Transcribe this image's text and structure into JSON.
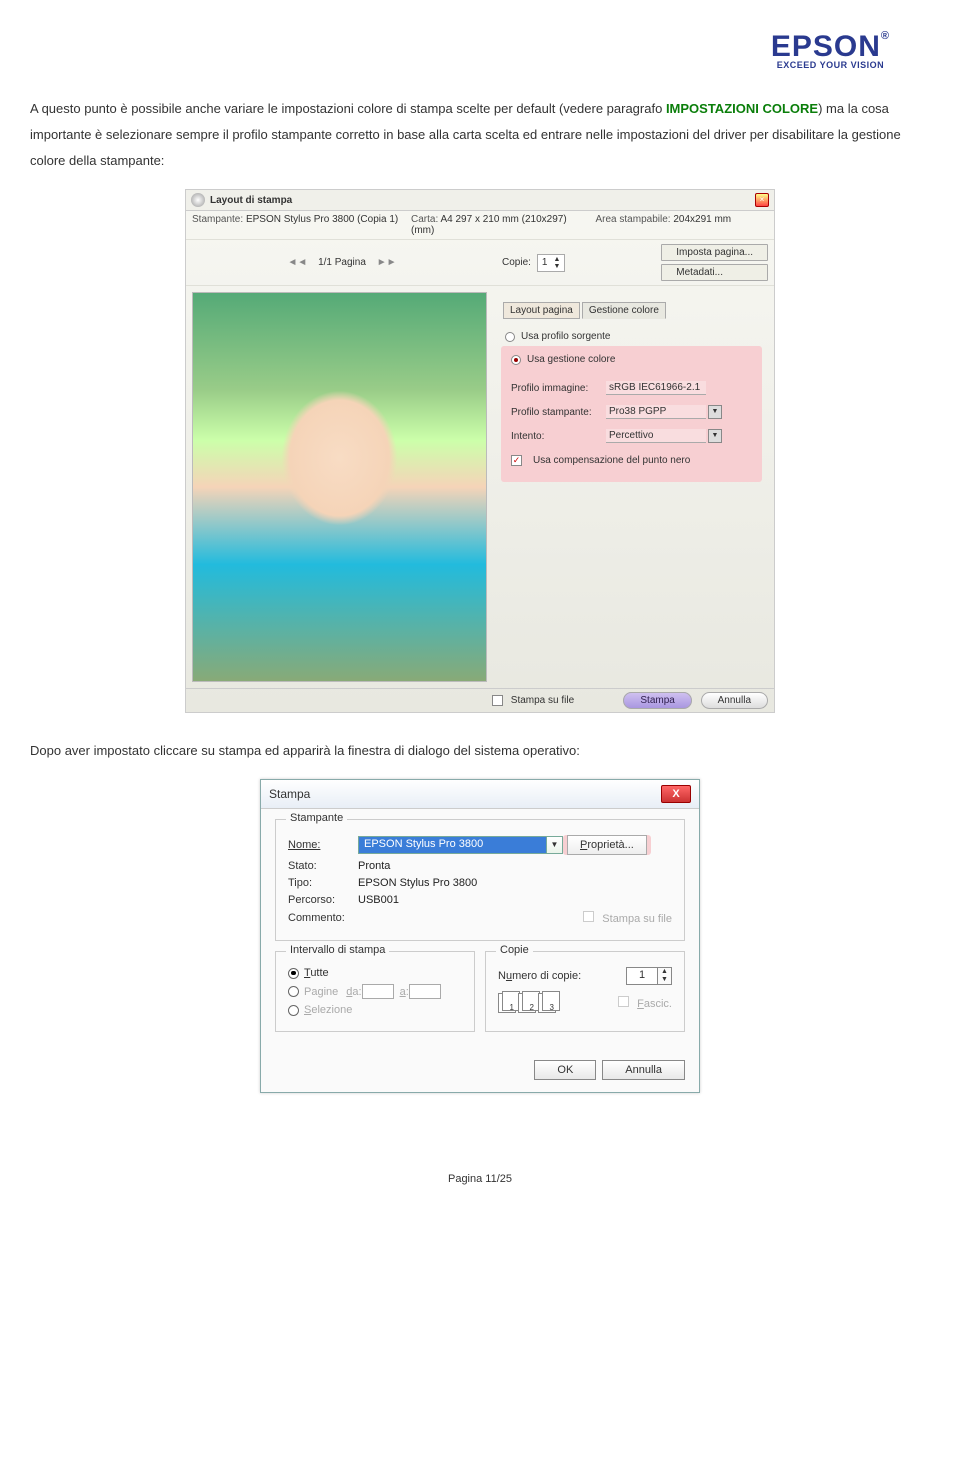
{
  "logo": {
    "title": "EPSON",
    "reg": "®",
    "tagline": "EXCEED YOUR VISION"
  },
  "para1": {
    "t1": "A questo punto è possibile anche variare le impostazioni colore di stampa scelte per default (vedere  paragrafo ",
    "imp": "IMPOSTAZIONI COLORE",
    "imp_close": ")",
    "t2": " ma la cosa importante è selezionare sempre il profilo stampante corretto in base alla carta scelta ed entrare nelle impostazioni del driver per disabilitare la gestione colore della stampante:"
  },
  "dialog1": {
    "title": "Layout di stampa",
    "printer_lbl": "Stampante:",
    "printer_val": "EPSON Stylus Pro 3800 (Copia 1)",
    "paper_lbl": "Carta:",
    "paper_val": "A4 297 x 210 mm (210x297) (mm)",
    "area_lbl": "Area stampabile:",
    "area_val": "204x291 mm",
    "pager": "1/1 Pagina",
    "copies_lbl": "Copie:",
    "copies_val": "1",
    "btn_page": "Imposta pagina...",
    "btn_meta": "Metadati...",
    "tab1": "Layout pagina",
    "tab2": "Gestione colore",
    "radio1": "Usa profilo sorgente",
    "radio2": "Usa gestione colore",
    "f1l": "Profilo immagine:",
    "f1v": "sRGB IEC61966-2.1",
    "f2l": "Profilo stampante:",
    "f2v": "Pro38 PGPP",
    "f3l": "Intento:",
    "f3v": "Percettivo",
    "chk1": "Usa compensazione del punto nero",
    "chk_file": "Stampa su file",
    "btn_print": "Stampa",
    "btn_cancel": "Annulla"
  },
  "para2": "Dopo aver impostato cliccare su stampa ed apparirà la finestra di dialogo del sistema operativo:",
  "dialog2": {
    "title": "Stampa",
    "grp_printer": "Stampante",
    "name_l": "Nome:",
    "name_v": "EPSON Stylus Pro 3800",
    "prop": "Proprietà...",
    "state_l": "Stato:",
    "state_v": "Pronta",
    "type_l": "Tipo:",
    "type_v": "EPSON Stylus Pro 3800",
    "path_l": "Percorso:",
    "path_v": "USB001",
    "comment_l": "Commento:",
    "chk_file": "Stampa su file",
    "grp_range": "Intervallo di stampa",
    "r_all": "Tutte",
    "r_pages": "Pagine",
    "from": "da:",
    "to": "a:",
    "r_sel": "Selezione",
    "grp_copies": "Copie",
    "ncopies_l": "Numero di copie:",
    "ncopies_v": "1",
    "c1": "1",
    "c2": "2",
    "c3": "3",
    "collate": "Fascic.",
    "ok": "OK",
    "cancel": "Annulla"
  },
  "footer": "Pagina 11/25"
}
